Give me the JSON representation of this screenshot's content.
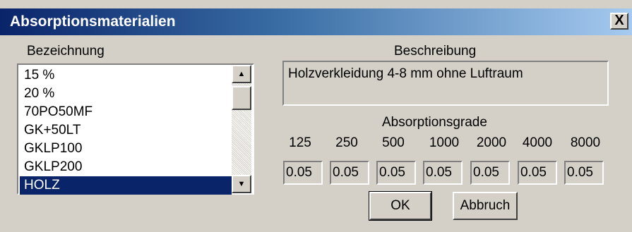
{
  "window": {
    "title": "Absorptionsmaterialien",
    "close_label": "X"
  },
  "list": {
    "header": "Bezeichnung",
    "items": [
      "15 %",
      "20 %",
      "70PO50MF",
      "GK+50LT",
      "GKLP100",
      "GKLP200",
      "HOLZ"
    ],
    "selected": "HOLZ",
    "scroll_up": "▲",
    "scroll_down": "▼"
  },
  "description": {
    "header": "Beschreibung",
    "text": "Holzverkleidung 4-8 mm ohne Luftraum"
  },
  "absorption": {
    "header": "Absorptionsgrade",
    "frequencies": [
      "125",
      "250",
      "500",
      "1000",
      "2000",
      "4000",
      "8000"
    ],
    "values": [
      "0.05",
      "0.05",
      "0.05",
      "0.05",
      "0.05",
      "0.05",
      "0.05"
    ]
  },
  "buttons": {
    "ok": "OK",
    "cancel": "Abbruch"
  }
}
